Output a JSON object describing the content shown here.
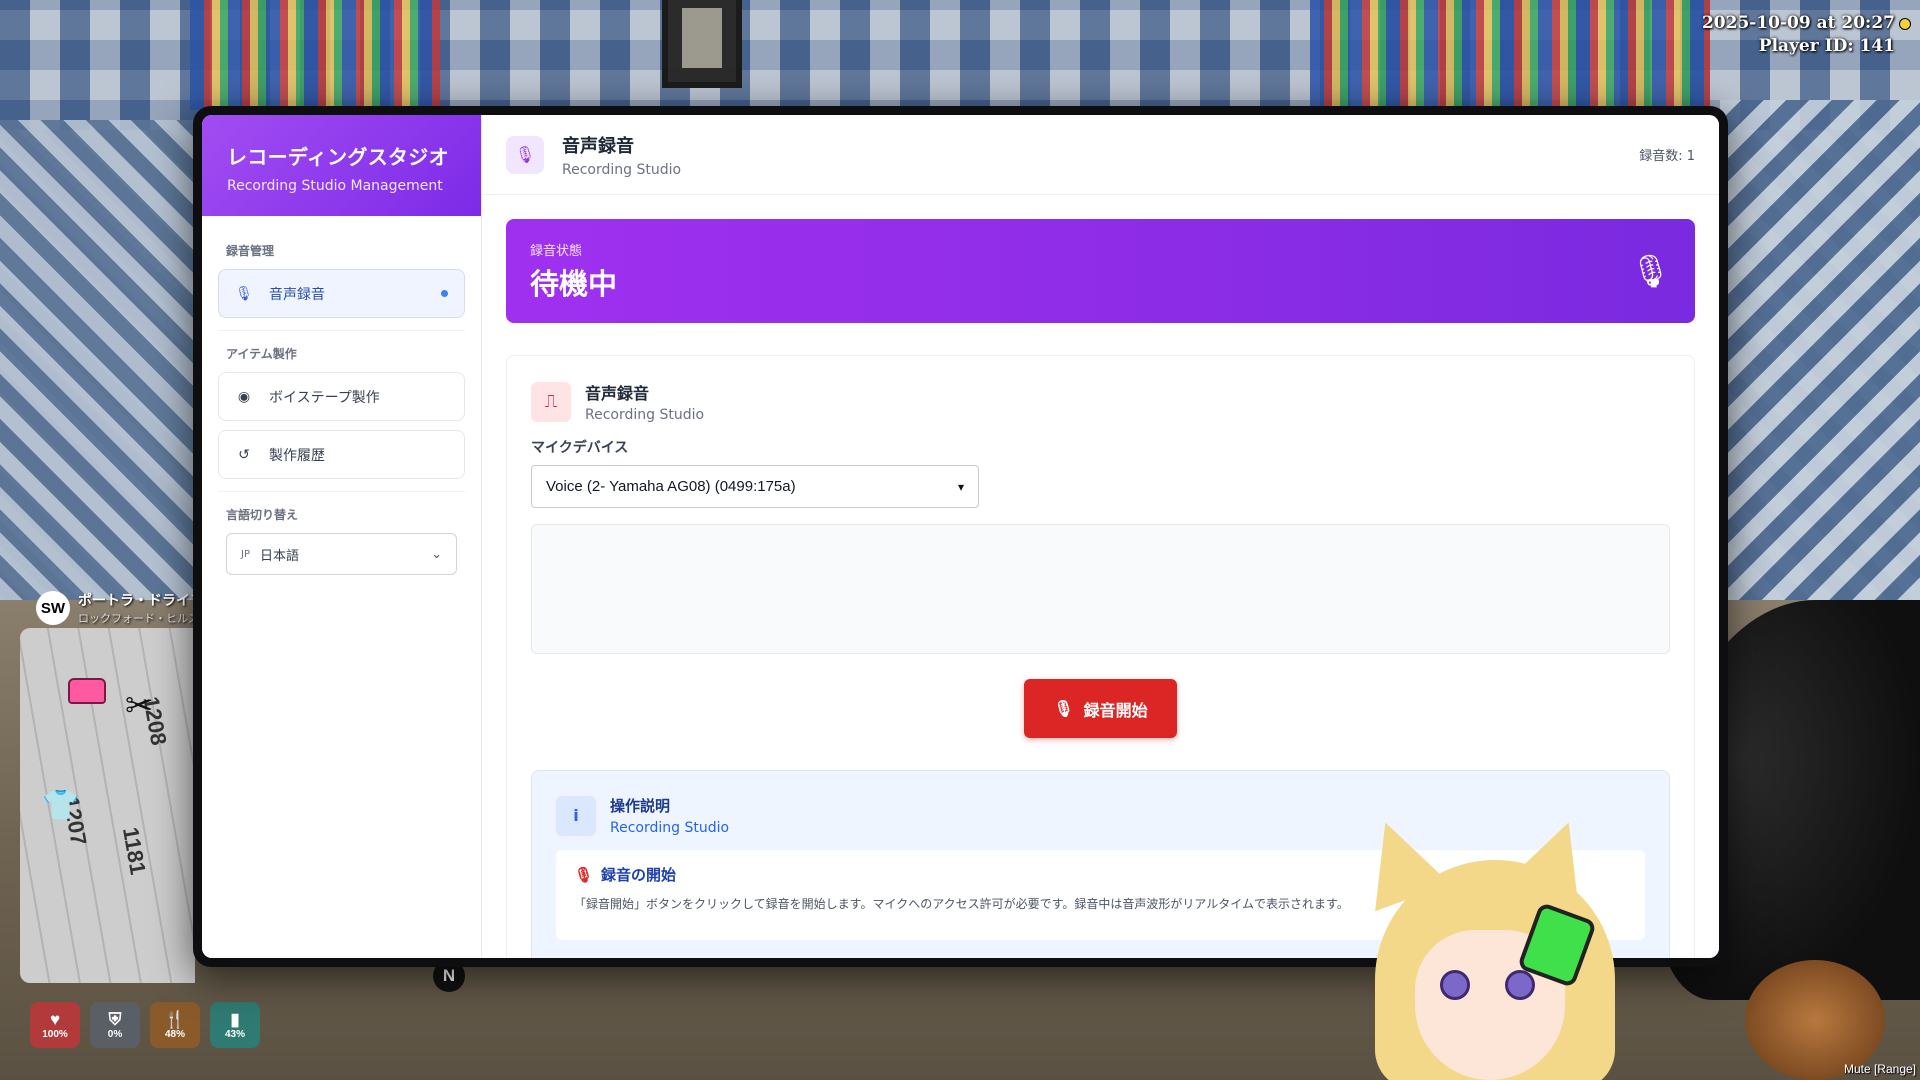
{
  "hud": {
    "datetime": "2025-10-09 at 20:27",
    "player_id": "Player ID: 141",
    "mute": "Mute [Range]"
  },
  "location": {
    "compass": "SW",
    "street": "ポートラ・ドライブ",
    "area": "ロックフォード・ヒルズ",
    "north": "N"
  },
  "status": [
    {
      "icon": "heart-icon",
      "value": "100%",
      "color": "#b33a3a"
    },
    {
      "icon": "shield-icon",
      "value": "0%",
      "color": "#5a5f66"
    },
    {
      "icon": "food-icon",
      "value": "48%",
      "color": "#8a5a2a"
    },
    {
      "icon": "water-icon",
      "value": "43%",
      "color": "#2f7a72"
    }
  ],
  "sidebar": {
    "title": "レコーディングスタジオ",
    "subtitle": "Recording Studio Management",
    "section1_label": "録音管理",
    "voice_recording": "音声録音",
    "section2_label": "アイテム製作",
    "voice_tape": "ボイステープ製作",
    "history": "製作履歴",
    "section3_label": "言語切り替え",
    "lang_flag": "JP",
    "lang_value": "日本語"
  },
  "topbar": {
    "title": "音声録音",
    "subtitle": "Recording Studio",
    "count": "録音数: 1"
  },
  "banner": {
    "label": "録音状態",
    "value": "待機中"
  },
  "recorder": {
    "title": "音声録音",
    "subtitle": "Recording Studio",
    "device_label": "マイクデバイス",
    "device_value": "Voice (2- Yamaha AG08) (0499:175a)",
    "start_button": "録音開始"
  },
  "help": {
    "title": "操作説明",
    "subtitle": "Recording Studio",
    "step_title": "録音の開始",
    "step_text": "「録音開始」ボタンをクリックして録音を開始します。マイクへのアクセス許可が必要です。録音中は音声波形がリアルタイムで表示されます。"
  },
  "colors": {
    "accent_purple": "#9333ea",
    "record_red": "#dc2626",
    "info_blue": "#2563eb"
  }
}
